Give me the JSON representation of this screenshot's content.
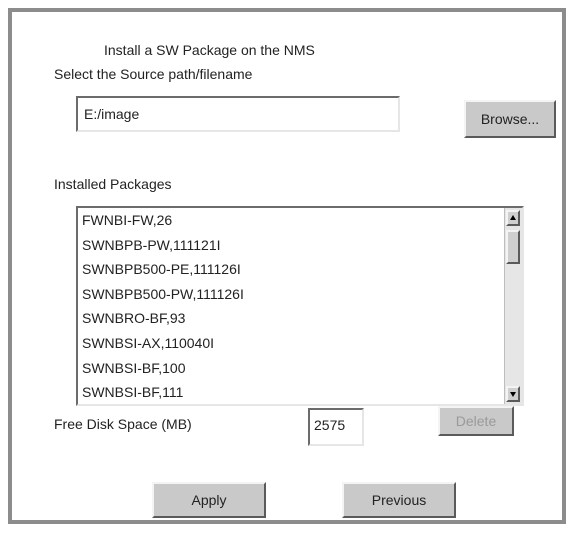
{
  "dialog": {
    "title": "Install a SW Package on the NMS",
    "source_label": "Select the Source path/filename",
    "source_value": "E:/image",
    "browse_label": "Browse...",
    "installed_label": "Installed Packages",
    "packages": [
      "FWNBI-FW,26",
      "SWNBPB-PW,111121I",
      "SWNBPB500-PE,111126I",
      "SWNBPB500-PW,111126I",
      "SWNBRO-BF,93",
      "SWNBSI-AX,110040I",
      "SWNBSI-BF,100",
      "SWNBSI-BF,111"
    ],
    "free_space_label": "Free Disk Space (MB)",
    "free_space_value": "2575",
    "delete_label": "Delete",
    "apply_label": "Apply",
    "previous_label": "Previous"
  }
}
